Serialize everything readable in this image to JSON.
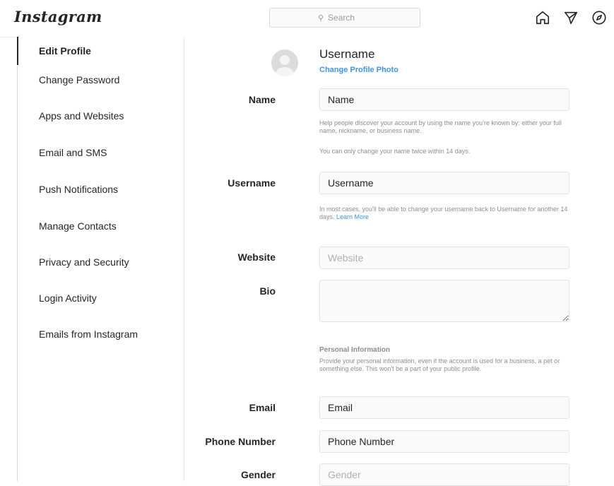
{
  "topbar": {
    "logo": "Instagram",
    "search_placeholder": "Search",
    "icons": [
      "home-icon",
      "direct-icon",
      "explore-icon"
    ]
  },
  "sidebar": {
    "items": [
      {
        "label": "Edit Profile",
        "active": true
      },
      {
        "label": "Change Password"
      },
      {
        "label": "Apps and Websites"
      },
      {
        "label": "Email and SMS"
      },
      {
        "label": "Push Notifications"
      },
      {
        "label": "Manage Contacts"
      },
      {
        "label": "Privacy and Security"
      },
      {
        "label": "Login Activity"
      },
      {
        "label": "Emails from Instagram"
      }
    ]
  },
  "profile": {
    "username": "Username",
    "change_photo": "Change Profile Photo"
  },
  "form": {
    "name": {
      "label": "Name",
      "value": "Name",
      "help1": "Help people discover your account by using the name you're known by: either your full name, nickname, or business name.",
      "help2": "You can only change your name twice within 14 days."
    },
    "username": {
      "label": "Username",
      "value": "Username",
      "help": "In most cases, you'll be able to change your username back to Username for another 14 days.",
      "learn_more": "Learn More"
    },
    "website": {
      "label": "Website",
      "placeholder": "Website"
    },
    "bio": {
      "label": "Bio",
      "value": ""
    },
    "personal_info": {
      "title": "Personal Information",
      "text": "Provide your personal information, even if the account is used for a business, a pet or something else. This won't be a part of your public profile."
    },
    "email": {
      "label": "Email",
      "value": "Email"
    },
    "phone": {
      "label": "Phone Number",
      "value": "Phone Number"
    },
    "gender": {
      "label": "Gender",
      "placeholder": "Gender"
    }
  },
  "colors": {
    "link": "#3897f0",
    "text": "#262626",
    "muted": "#8e8e8e",
    "border": "#dbdbdb"
  }
}
